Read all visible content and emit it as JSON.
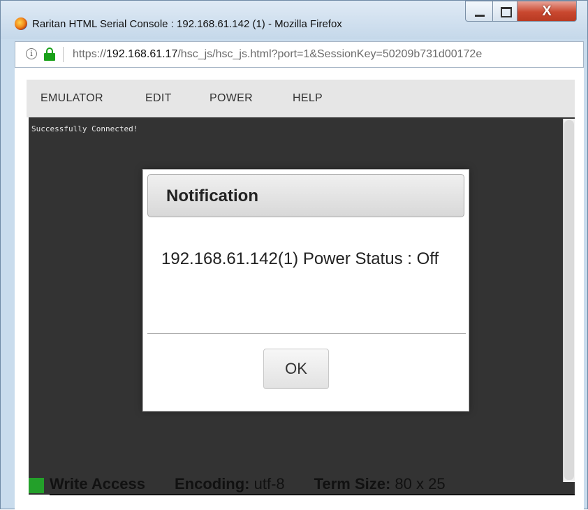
{
  "window": {
    "title": "Raritan HTML Serial Console : 192.168.61.142 (1) - Mozilla Firefox",
    "close_glyph": "X"
  },
  "urlbar": {
    "scheme": "https://",
    "host": "192.168.61.17",
    "path": "/hsc_js/hsc_js.html?port=1&SessionKey=50209b731d00172e"
  },
  "menu": {
    "items": [
      {
        "label": "EMULATOR"
      },
      {
        "label": "EDIT"
      },
      {
        "label": "POWER"
      },
      {
        "label": "HELP"
      }
    ]
  },
  "terminal": {
    "lines": [
      "Successfully Connected!"
    ]
  },
  "statusbar": {
    "access": "Write Access",
    "encoding_label": "Encoding:",
    "encoding_value": "utf-8",
    "termsize_label": "Term Size:",
    "termsize_value": "80 x 25",
    "access_color": "#23a02a"
  },
  "modal": {
    "title": "Notification",
    "message": "192.168.61.142(1) Power Status : Off",
    "ok_label": "OK"
  }
}
